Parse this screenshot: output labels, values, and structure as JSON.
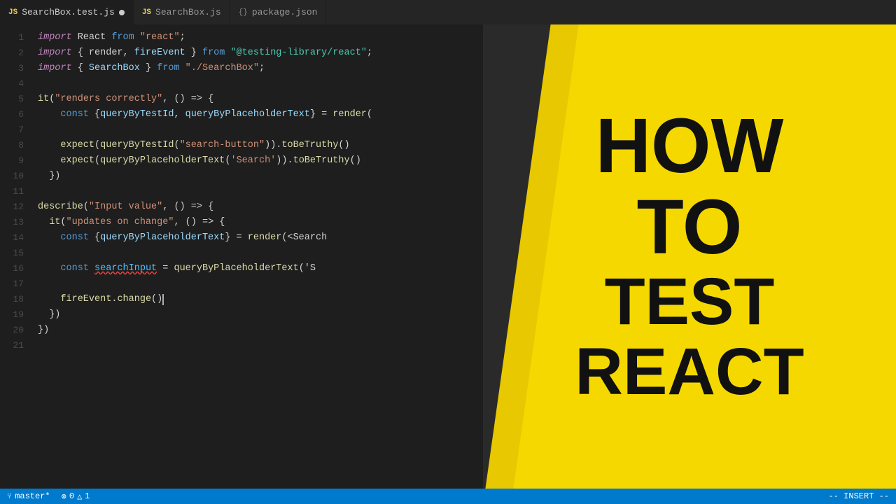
{
  "tabs": [
    {
      "id": "searchbox-test",
      "label": "SearchBox.test.js",
      "icon": "js",
      "active": true,
      "modified": true
    },
    {
      "id": "searchbox",
      "label": "SearchBox.js",
      "icon": "js",
      "active": false,
      "modified": false
    },
    {
      "id": "package",
      "label": "package.json",
      "icon": "pkg",
      "active": false,
      "modified": false
    }
  ],
  "code_lines": [
    {
      "num": 1,
      "tokens": [
        {
          "t": "kw-italic",
          "v": "import"
        },
        {
          "t": "plain",
          "v": " React "
        },
        {
          "t": "plain",
          "v": "from"
        },
        {
          "t": "plain",
          "v": " "
        },
        {
          "t": "str",
          "v": "\"react\""
        },
        {
          "t": "plain",
          "v": ";"
        }
      ]
    },
    {
      "num": 2,
      "tokens": [
        {
          "t": "kw-italic",
          "v": "import"
        },
        {
          "t": "plain",
          "v": " { render, fireEvent } "
        },
        {
          "t": "plain",
          "v": "from"
        },
        {
          "t": "plain",
          "v": " "
        },
        {
          "t": "str2",
          "v": "\"@testing-library/react\""
        },
        {
          "t": "plain",
          "v": ";"
        }
      ]
    },
    {
      "num": 3,
      "tokens": [
        {
          "t": "kw-italic",
          "v": "import"
        },
        {
          "t": "plain",
          "v": " { SearchBox } "
        },
        {
          "t": "plain",
          "v": "from"
        },
        {
          "t": "plain",
          "v": " "
        },
        {
          "t": "str",
          "v": "\"./SearchBox\""
        },
        {
          "t": "plain",
          "v": ";"
        }
      ]
    },
    {
      "num": 4,
      "tokens": []
    },
    {
      "num": 5,
      "tokens": [
        {
          "t": "fn",
          "v": "it"
        },
        {
          "t": "plain",
          "v": "("
        },
        {
          "t": "str",
          "v": "\"renders correctly\""
        },
        {
          "t": "plain",
          "v": ", () "
        },
        {
          "t": "arrow",
          "v": "=>"
        },
        {
          "t": "plain",
          "v": " {"
        }
      ]
    },
    {
      "num": 6,
      "tokens": [
        {
          "t": "plain",
          "v": "    "
        },
        {
          "t": "kw",
          "v": "const"
        },
        {
          "t": "plain",
          "v": " {"
        },
        {
          "t": "lightblue",
          "v": "queryByTestId"
        },
        {
          "t": "plain",
          "v": ", "
        },
        {
          "t": "lightblue",
          "v": "queryByPlaceholderText"
        },
        {
          "t": "plain",
          "v": "} = "
        },
        {
          "t": "fn",
          "v": "render"
        },
        {
          "t": "plain",
          "v": "("
        }
      ]
    },
    {
      "num": 7,
      "tokens": []
    },
    {
      "num": 8,
      "tokens": [
        {
          "t": "plain",
          "v": "    "
        },
        {
          "t": "fn",
          "v": "expect"
        },
        {
          "t": "plain",
          "v": "("
        },
        {
          "t": "fn",
          "v": "queryByTestId"
        },
        {
          "t": "plain",
          "v": "("
        },
        {
          "t": "str",
          "v": "\"search-button\""
        },
        {
          "t": "plain",
          "v": "))."
        },
        {
          "t": "fn",
          "v": "toBeTruthy"
        },
        {
          "t": "plain",
          "v": "()"
        }
      ]
    },
    {
      "num": 9,
      "tokens": [
        {
          "t": "plain",
          "v": "    "
        },
        {
          "t": "fn",
          "v": "expect"
        },
        {
          "t": "plain",
          "v": "("
        },
        {
          "t": "fn",
          "v": "queryByPlaceholderText"
        },
        {
          "t": "plain",
          "v": "("
        },
        {
          "t": "str",
          "v": "'Search'"
        },
        {
          "t": "plain",
          "v": "))."
        },
        {
          "t": "fn",
          "v": "toBeTruthy"
        },
        {
          "t": "plain",
          "v": "()"
        }
      ]
    },
    {
      "num": 10,
      "tokens": [
        {
          "t": "plain",
          "v": "  })"
        }
      ]
    },
    {
      "num": 11,
      "tokens": []
    },
    {
      "num": 12,
      "tokens": [
        {
          "t": "fn",
          "v": "describe"
        },
        {
          "t": "plain",
          "v": "("
        },
        {
          "t": "str",
          "v": "\"Input value\""
        },
        {
          "t": "plain",
          "v": ", () "
        },
        {
          "t": "arrow",
          "v": "=>"
        },
        {
          "t": "plain",
          "v": " {"
        }
      ]
    },
    {
      "num": 13,
      "tokens": [
        {
          "t": "plain",
          "v": "  "
        },
        {
          "t": "fn",
          "v": "it"
        },
        {
          "t": "plain",
          "v": "("
        },
        {
          "t": "str",
          "v": "\"updates on change\""
        },
        {
          "t": "plain",
          "v": ", () "
        },
        {
          "t": "arrow",
          "v": "=>"
        },
        {
          "t": "plain",
          "v": " {"
        }
      ]
    },
    {
      "num": 14,
      "tokens": [
        {
          "t": "plain",
          "v": "    "
        },
        {
          "t": "kw",
          "v": "const"
        },
        {
          "t": "plain",
          "v": " {"
        },
        {
          "t": "lightblue",
          "v": "queryByPlaceholderText"
        },
        {
          "t": "plain",
          "v": "} = "
        },
        {
          "t": "fn",
          "v": "render"
        },
        {
          "t": "plain",
          "v": "(<Search"
        }
      ]
    },
    {
      "num": 15,
      "tokens": []
    },
    {
      "num": 16,
      "tokens": [
        {
          "t": "plain",
          "v": "    "
        },
        {
          "t": "kw",
          "v": "const"
        },
        {
          "t": "plain",
          "v": " "
        },
        {
          "t": "var2",
          "v": "searchInput"
        },
        {
          "t": "plain",
          "v": " = "
        },
        {
          "t": "fn",
          "v": "queryByPlaceholderText"
        },
        {
          "t": "plain",
          "v": "('S"
        }
      ]
    },
    {
      "num": 17,
      "tokens": []
    },
    {
      "num": 18,
      "tokens": [
        {
          "t": "plain",
          "v": "    "
        },
        {
          "t": "fn",
          "v": "fireEvent"
        },
        {
          "t": "plain",
          "v": "."
        },
        {
          "t": "fn",
          "v": "change"
        },
        {
          "t": "plain",
          "v": "()"
        },
        {
          "t": "cursor_here",
          "v": "true"
        }
      ]
    },
    {
      "num": 19,
      "tokens": [
        {
          "t": "plain",
          "v": "  })"
        }
      ]
    },
    {
      "num": 20,
      "tokens": [
        {
          "t": "plain",
          "v": "})"
        }
      ]
    },
    {
      "num": 21,
      "tokens": []
    }
  ],
  "yellow_text": {
    "line1": "HOW",
    "line2": "TO",
    "line3": "TEST",
    "line4": "REACT"
  },
  "status_bar": {
    "branch": "master*",
    "errors": "0",
    "warnings": "1",
    "mode": "-- INSERT --"
  }
}
